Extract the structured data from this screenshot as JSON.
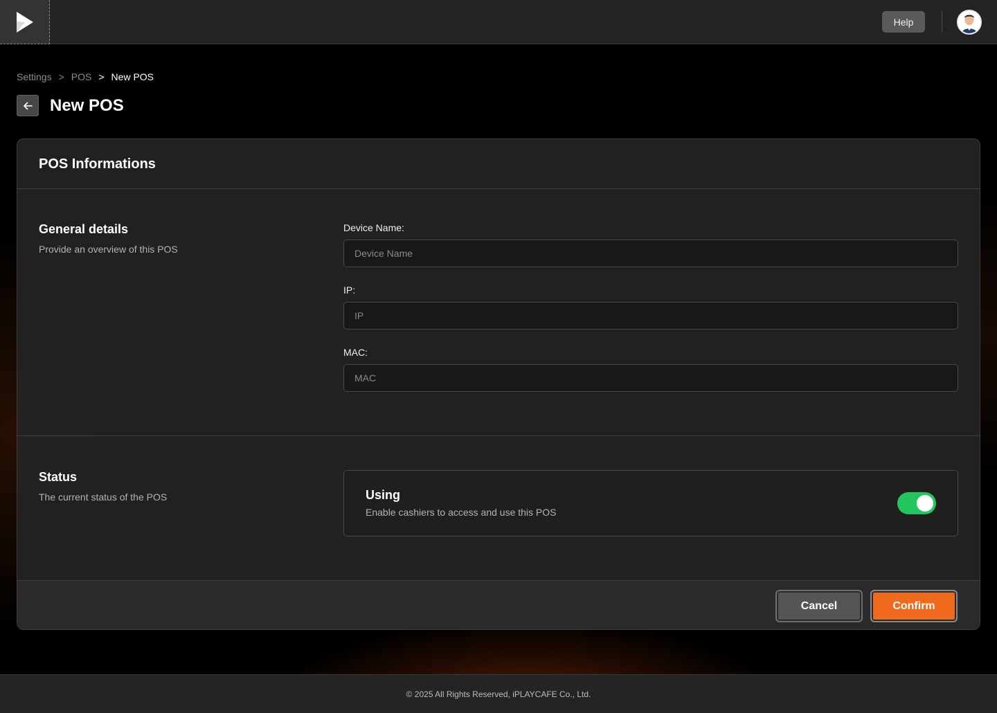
{
  "header": {
    "help_label": "Help",
    "logo_icon": "play-logo-icon",
    "avatar_icon": "user-avatar"
  },
  "breadcrumb": {
    "items": [
      "Settings",
      "POS",
      "New POS"
    ],
    "separator": ">"
  },
  "page": {
    "title": "New POS",
    "back_icon": "arrow-left-icon"
  },
  "card": {
    "title": "POS Informations",
    "general": {
      "title": "General details",
      "description": "Provide an overview of this POS",
      "fields": [
        {
          "label": "Device Name:",
          "placeholder": "Device Name",
          "value": ""
        },
        {
          "label": "IP:",
          "placeholder": "IP",
          "value": ""
        },
        {
          "label": "MAC:",
          "placeholder": "MAC",
          "value": ""
        }
      ]
    },
    "status": {
      "title": "Status",
      "description": "The current status of the POS",
      "option_title": "Using",
      "option_description": "Enable cashiers to access and use this POS",
      "enabled": true
    },
    "actions": {
      "cancel_label": "Cancel",
      "confirm_label": "Confirm"
    }
  },
  "footer": {
    "copyright": "© 2025 All Rights Reserved, iPLAYCAFE Co., Ltd."
  },
  "colors": {
    "accent": "#f06a1d",
    "toggle_on": "#22c55e"
  }
}
